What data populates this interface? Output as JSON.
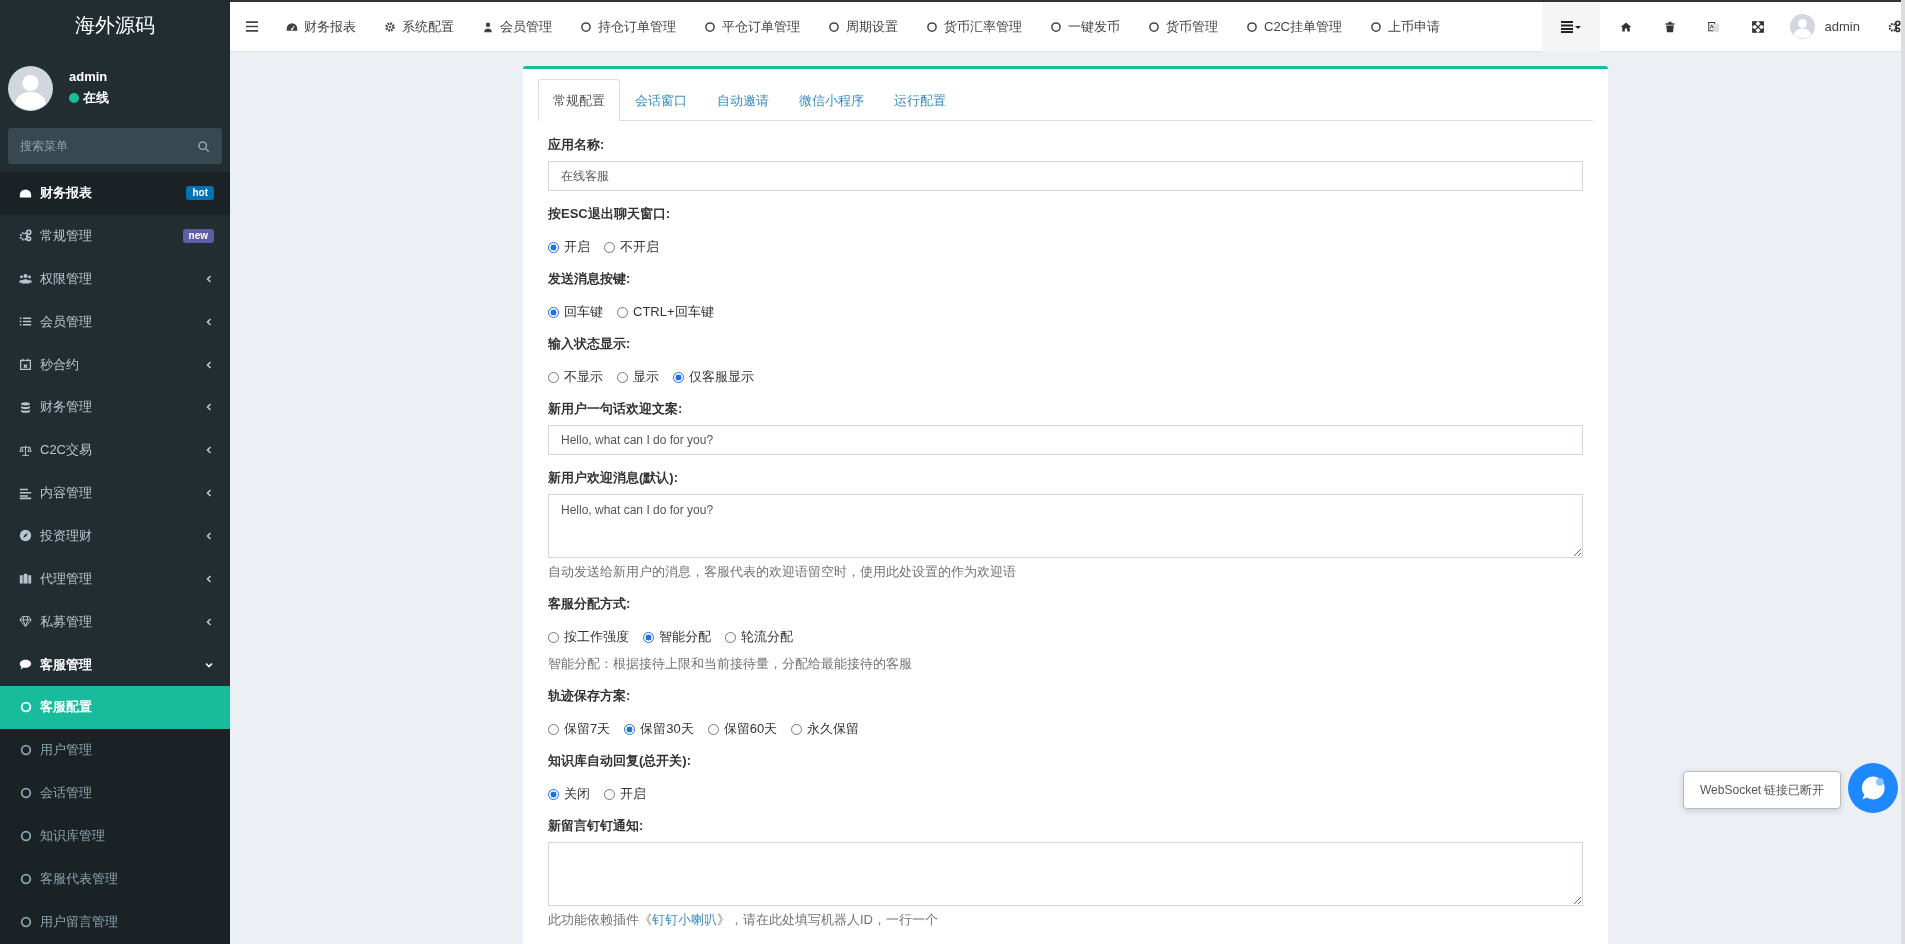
{
  "sidebar": {
    "logo": "海外源码",
    "user": {
      "name": "admin",
      "online": true,
      "status": "在线"
    },
    "search": {
      "placeholder": "搜索菜单"
    },
    "items": [
      {
        "label": "财务报表",
        "selected": true,
        "badge": {
          "text": "hot",
          "color": "#0073b7"
        }
      },
      {
        "label": "常规管理",
        "selected": false,
        "badge": {
          "text": "new",
          "color": "#605ca8"
        }
      },
      {
        "label": "权限管理",
        "selected": false,
        "expanded": false
      },
      {
        "label": "会员管理",
        "selected": false,
        "expanded": false
      },
      {
        "label": "秒合约",
        "selected": false,
        "expanded": false
      },
      {
        "label": "财务管理",
        "selected": false,
        "expanded": false
      },
      {
        "label": "C2C交易",
        "selected": false,
        "expanded": false
      },
      {
        "label": "内容管理",
        "selected": false,
        "expanded": false
      },
      {
        "label": "投资理财",
        "selected": false,
        "expanded": false
      },
      {
        "label": "代理管理",
        "selected": false,
        "expanded": false
      },
      {
        "label": "私募管理",
        "selected": false,
        "expanded": false
      },
      {
        "label": "客服管理",
        "selected": false,
        "expanded": true,
        "children": [
          {
            "label": "客服配置",
            "selected": true
          },
          {
            "label": "用户管理",
            "selected": false
          },
          {
            "label": "会话管理",
            "selected": false
          },
          {
            "label": "知识库管理",
            "selected": false
          },
          {
            "label": "客服代表管理",
            "selected": false
          },
          {
            "label": "用户留言管理",
            "selected": false
          }
        ]
      }
    ]
  },
  "topbar": {
    "nav": [
      "财务报表",
      "系统配置",
      "会员管理",
      "持仓订单管理",
      "平仓订单管理",
      "周期设置",
      "货币汇率管理",
      "一键发币",
      "货币管理",
      "C2C挂单管理",
      "上币申请"
    ],
    "user": "admin"
  },
  "tabs": [
    {
      "label": "常规配置",
      "selected": true
    },
    {
      "label": "会话窗口",
      "selected": false
    },
    {
      "label": "自动邀请",
      "selected": false
    },
    {
      "label": "微信小程序",
      "selected": false
    },
    {
      "label": "运行配置",
      "selected": false
    }
  ],
  "form": [
    {
      "kind": "text",
      "label": "应用名称:",
      "value": "在线客服"
    },
    {
      "kind": "radio",
      "label": "按ESC退出聊天窗口:",
      "options": [
        {
          "label": "开启",
          "selected": true
        },
        {
          "label": "不开启",
          "selected": false
        }
      ]
    },
    {
      "kind": "radio",
      "label": "发送消息按键:",
      "options": [
        {
          "label": "回车键",
          "selected": true
        },
        {
          "label": "CTRL+回车键",
          "selected": false
        }
      ]
    },
    {
      "kind": "radio",
      "label": "输入状态显示:",
      "options": [
        {
          "label": "不显示",
          "selected": false
        },
        {
          "label": "显示",
          "selected": false
        },
        {
          "label": "仅客服显示",
          "selected": true
        }
      ]
    },
    {
      "kind": "text",
      "label": "新用户一句话欢迎文案:",
      "value": "Hello, what can I do for you?"
    },
    {
      "kind": "textarea",
      "label": "新用户欢迎消息(默认):",
      "value": "Hello, what can I do for you?",
      "help": "自动发送给新用户的消息，客服代表的欢迎语留空时，使用此处设置的作为欢迎语"
    },
    {
      "kind": "radio",
      "label": "客服分配方式:",
      "options": [
        {
          "label": "按工作强度",
          "selected": false
        },
        {
          "label": "智能分配",
          "selected": true
        },
        {
          "label": "轮流分配",
          "selected": false
        }
      ],
      "help": "智能分配：根据接待上限和当前接待量，分配给最能接待的客服"
    },
    {
      "kind": "radio",
      "label": "轨迹保存方案:",
      "options": [
        {
          "label": "保留7天",
          "selected": false
        },
        {
          "label": "保留30天",
          "selected": true
        },
        {
          "label": "保留60天",
          "selected": false
        },
        {
          "label": "永久保留",
          "selected": false
        }
      ]
    },
    {
      "kind": "radio",
      "label": "知识库自动回复(总开关):",
      "options": [
        {
          "label": "关闭",
          "selected": true
        },
        {
          "label": "开启",
          "selected": false
        }
      ]
    },
    {
      "kind": "textarea",
      "label": "新留言钉钉通知:",
      "help_before": "此功能依赖插件《",
      "help_link": "钉钉小喇叭",
      "help_after": "》，请在此处填写机器人ID，一行一个"
    }
  ],
  "toast": {
    "text": "WebSocket 链接已断开"
  }
}
